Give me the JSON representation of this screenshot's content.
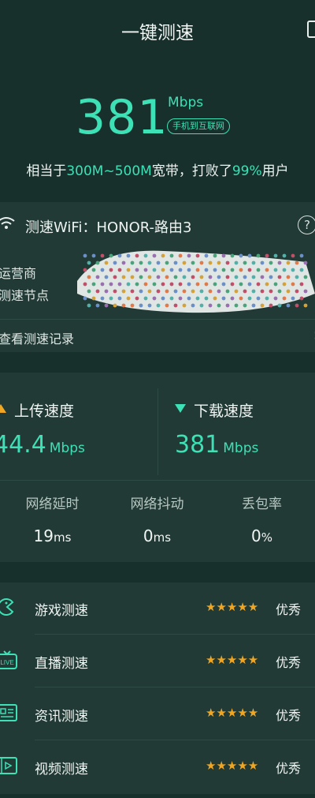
{
  "header": {
    "title": "一键测速"
  },
  "speed": {
    "value": "381",
    "unit": "Mbps",
    "badge": "手机到互联网",
    "summary_prefix": "相当于",
    "summary_range": "300M~500M",
    "summary_mid": "宽带，打败了",
    "summary_percent": "99%",
    "summary_suffix": "用户"
  },
  "network": {
    "wifi_label": "测速WiFi：HONOR-路由3",
    "operator_label": "运营商",
    "node_label": "测速节点",
    "records_link": "查看测速记录"
  },
  "rates": {
    "upload_label": "上传速度",
    "upload_value": "44.4",
    "upload_unit": "Mbps",
    "download_label": "下载速度",
    "download_value": "381",
    "download_unit": "Mbps"
  },
  "metrics": [
    {
      "label": "网络延时",
      "value": "19",
      "unit": "ms"
    },
    {
      "label": "网络抖动",
      "value": "0",
      "unit": "ms"
    },
    {
      "label": "丢包率",
      "value": "0",
      "unit": "%"
    }
  ],
  "tests": [
    {
      "label": "游戏测速",
      "stars": "★★★★★",
      "rating": "优秀",
      "icon": "game-icon"
    },
    {
      "label": "直播测速",
      "stars": "★★★★★",
      "rating": "优秀",
      "icon": "live-icon"
    },
    {
      "label": "资讯测速",
      "stars": "★★★★★",
      "rating": "优秀",
      "icon": "news-icon"
    },
    {
      "label": "视频测速",
      "stars": "★★★★★",
      "rating": "优秀",
      "icon": "video-icon"
    }
  ],
  "colors": {
    "accent": "#3ee0b6",
    "star": "#f1a623",
    "background": "#17302b",
    "card": "#213a35"
  }
}
